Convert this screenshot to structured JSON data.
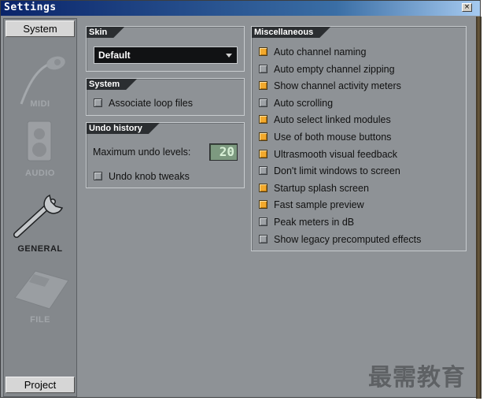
{
  "window": {
    "title": "Settings",
    "close_glyph": "×"
  },
  "sidebar": {
    "top_tab": "System",
    "bottom_tab": "Project",
    "items": [
      {
        "label": "MIDI",
        "icon": "midi-cable-icon",
        "active": false
      },
      {
        "label": "AUDIO",
        "icon": "speaker-icon",
        "active": false
      },
      {
        "label": "GENERAL",
        "icon": "wrench-icon",
        "active": true
      },
      {
        "label": "FILE",
        "icon": "floppy-disk-icon",
        "active": false
      }
    ]
  },
  "skin": {
    "title": "Skin",
    "selected": "Default"
  },
  "system": {
    "title": "System",
    "associate_loop_files": {
      "label": "Associate loop files",
      "checked": false
    }
  },
  "undo": {
    "title": "Undo history",
    "max_levels_label": "Maximum undo levels:",
    "max_levels_value": "20",
    "knob_tweaks": {
      "label": "Undo knob tweaks",
      "checked": false
    }
  },
  "misc": {
    "title": "Miscellaneous",
    "options": [
      {
        "label": "Auto channel naming",
        "checked": true
      },
      {
        "label": "Auto empty channel zipping",
        "checked": false
      },
      {
        "label": "Show channel activity meters",
        "checked": true
      },
      {
        "label": "Auto scrolling",
        "checked": false
      },
      {
        "label": "Auto select linked modules",
        "checked": true
      },
      {
        "label": "Use of both mouse buttons",
        "checked": true
      },
      {
        "label": "Ultrasmooth visual feedback",
        "checked": true
      },
      {
        "label": "Don't limit windows to screen",
        "checked": false
      },
      {
        "label": "Startup splash screen",
        "checked": true
      },
      {
        "label": "Fast sample preview",
        "checked": true
      },
      {
        "label": "Peak meters in dB",
        "checked": false
      },
      {
        "label": "Show legacy precomputed effects",
        "checked": false
      }
    ]
  },
  "watermark": "最需教育",
  "colors": {
    "accent_checked": "#f3a92c",
    "titlebar": "#0a246a",
    "panel_title_bg": "#2b2e31"
  }
}
